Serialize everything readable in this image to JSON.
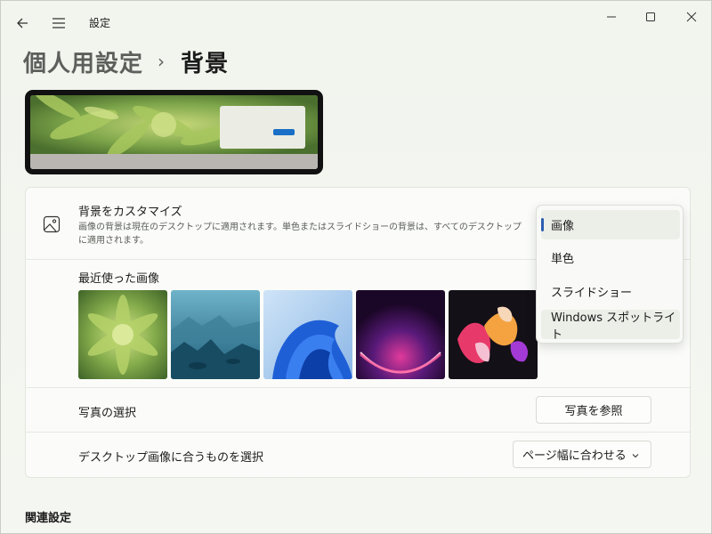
{
  "window": {
    "title": "設定"
  },
  "breadcrumb": {
    "parent": "個人用設定",
    "separator": "›",
    "current": "背景"
  },
  "customize": {
    "title": "背景をカスタマイズ",
    "description": "画像の背景は現在のデスクトップに適用されます。単色またはスライドショーの背景は、すべてのデスクトップに適用されます。"
  },
  "recent": {
    "label": "最近使った画像",
    "images": [
      "aloe-succulent",
      "rocky-coast",
      "blue-bloom",
      "purple-glow",
      "abstract-flowers"
    ]
  },
  "photo_select": {
    "label": "写真の選択",
    "button": "写真を参照"
  },
  "fit": {
    "label": "デスクトップ画像に合うものを選択",
    "value": "ページ幅に合わせる"
  },
  "background_type_dropdown": {
    "options": [
      "画像",
      "単色",
      "スライドショー",
      "Windows スポットライト"
    ],
    "selected": "画像"
  },
  "related": {
    "label": "関連設定"
  },
  "colors": {
    "accent": "#2a5db0",
    "window_bg": "#f3f6ef",
    "card_bg": "#fbfcf9"
  }
}
